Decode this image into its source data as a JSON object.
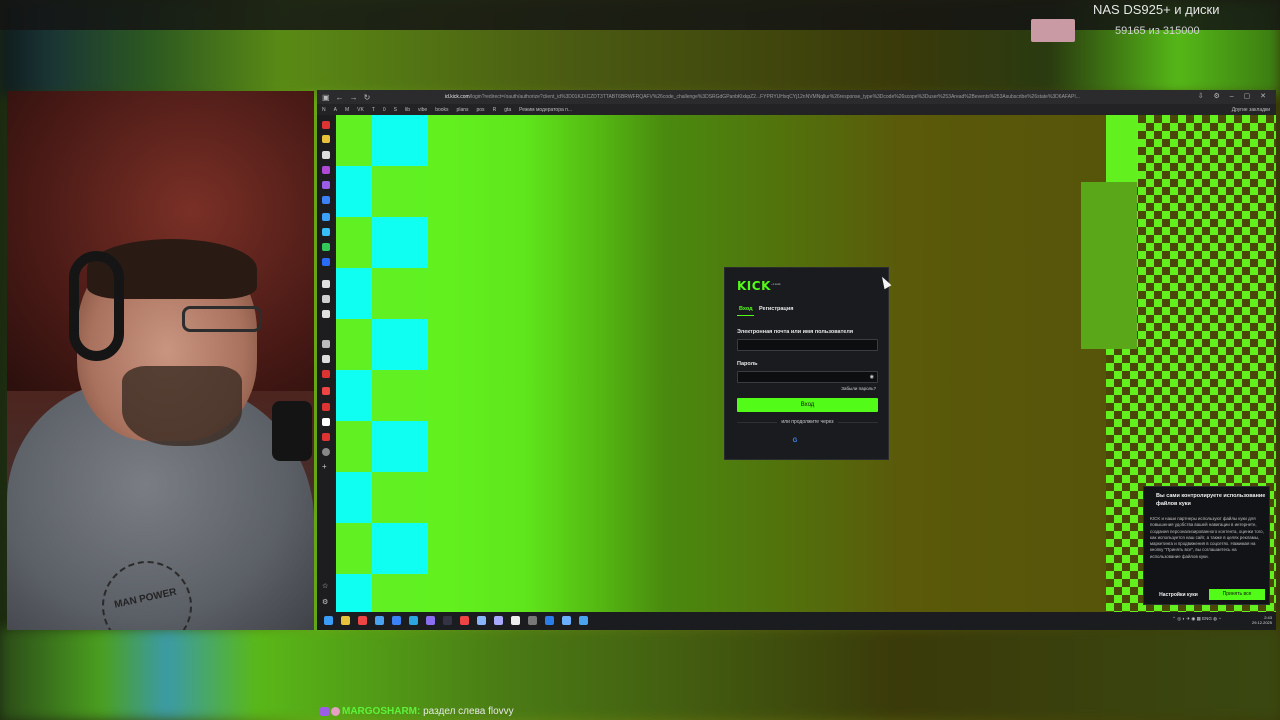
{
  "overlay": {
    "title": "NAS DS925+ и диски",
    "count": "59165 из 315000"
  },
  "browser": {
    "url_host": "id.kick.com",
    "url_path": "/login?redirect=/oauth/authorize?client_id%3D01KJXCZDT3TTABT6BRWFRQAFV%26code_challenge%3DSRGdGPanbKlxkpZ2...FYPRYUHxqCYj12nNVMNqllur%26response_type%3Dcode%26scope%3Duser%253Aread%2Bevents%253Asubscribe%26state%3D6AFAPI...",
    "bookmarks": [
      "N",
      "A",
      "M",
      "VK",
      "T",
      "0",
      "S",
      "lib",
      "vibe",
      "books",
      "plans",
      "pos",
      "R",
      "gta",
      "Режим модератора п..."
    ],
    "other_bookmarks": "Другие закладки"
  },
  "login": {
    "logo": "KICK",
    "tab_login": "Вход",
    "tab_register": "Регистрация",
    "email_label": "Электронная почта или имя пользователя",
    "password_label": "Пароль",
    "forgot": "Забыли пароль?",
    "submit": "Вход",
    "or": "или продолжите через",
    "google": "G",
    "apple": ""
  },
  "cookie": {
    "title": "Вы сами контролируете использование файлов куки",
    "body": "KICK и наши партнеры используют файлы куки для повышения удобства вашей навигации в интернете, создания персонализированного контента, оценки того, как используется наш сайт, а также в целях рекламы, маркетинга и продвижения в соцсетях. Нажимая на кнопку \"Принять все\", вы соглашаетесь на использование файлов куки.",
    "settings": "Настройки куки",
    "accept": "Принять все"
  },
  "taskbar": {
    "tray": "ENG",
    "time": "2:43",
    "date": "29.12.2025"
  },
  "chat": {
    "user": "MARGOSHARM",
    "message": " раздел слева flovvy"
  },
  "colors": {
    "kick_green": "#53fc18",
    "cyan": "#0ffff3"
  }
}
